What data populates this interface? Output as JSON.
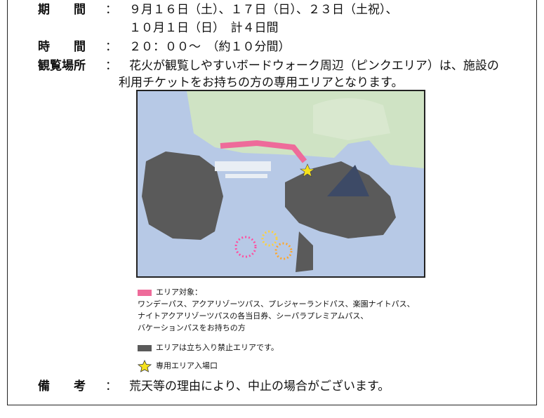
{
  "period": {
    "label": "期　　間",
    "colon": "：",
    "line1": "９月１６日（土）、１７日（日）、２３日（土祝）、",
    "line2": "１０月１日（日）　計４日間"
  },
  "time": {
    "label": "時　　間",
    "colon": "：",
    "value": "２０：００～　（約１０分間）"
  },
  "place": {
    "label": "観覧場所",
    "colon": "：",
    "line1": "花火が観覧しやすいボードウォーク周辺（ピンクエリア）は、施設の",
    "line2": "利用チケットをお持ちの方の専用エリアとなります。"
  },
  "legend": {
    "pink_title": "エリア対象：",
    "pink_lines": [
      "ワンデーパス、アクアリゾーツパス、プレジャーランドパス、楽園ナイトパス、",
      "ナイトアクアリゾーツパスの各当日券、シーパラプレミアムパス、",
      "バケーションパスをお持ちの方"
    ],
    "gray_text": "エリアは立ち入り禁止エリアです。",
    "star_text": "専用エリア入場口"
  },
  "note": {
    "label": "備　　考",
    "colon": "：",
    "value": "荒天等の理由により、中止の場合がございます。"
  },
  "colors": {
    "pink": "#ee6b9a",
    "gray": "#5a5a5a",
    "star": "#f5e11c",
    "water": "#b7c9e6"
  }
}
